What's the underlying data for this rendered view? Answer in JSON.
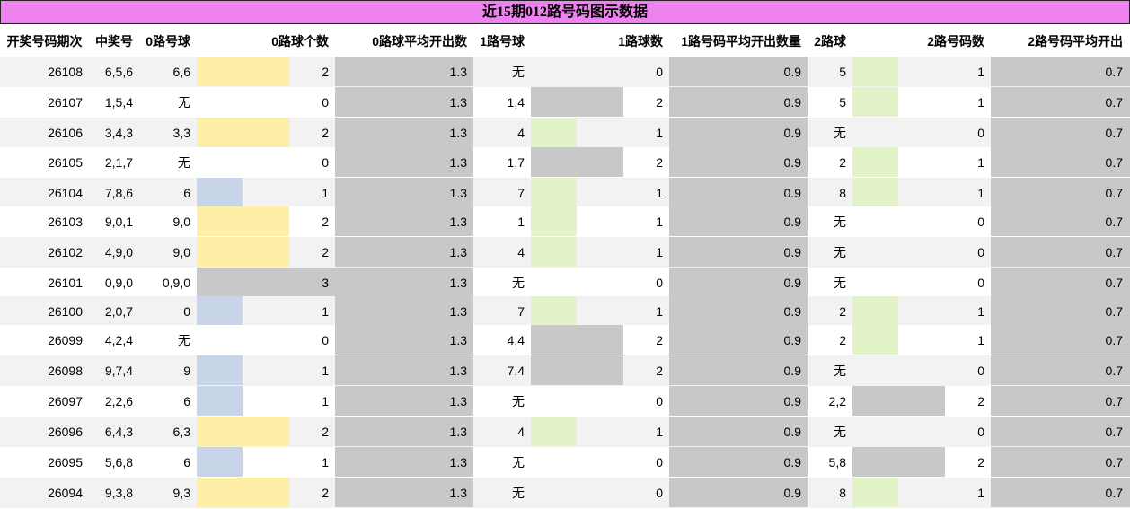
{
  "title": "近15期012路号码图示数据",
  "headers": [
    "开奖号码期次",
    "中奖号",
    "0路号球",
    "0路球个数",
    "0路球平均开出数",
    "1路号球",
    "1路球数",
    "1路号码平均开出数量",
    "2路球",
    "2路号码数",
    "2路号码平均开出"
  ],
  "colors": {
    "title_bg": "#ee82ee",
    "avg_col_bg": "#c8c8c8",
    "count1_route0": "#c8d4e8",
    "count2_route0": "#fdeea8",
    "count1_route12": "#e2f3c8",
    "count2_route12": "#c8c8c8",
    "count3": "#c8c8c8",
    "stripe": "#f2f2f2"
  },
  "max_count": 3,
  "rows": [
    {
      "period": "26108",
      "draw": "6,5,6",
      "r0_nums": "6,6",
      "r0_count": "2",
      "r0_avg": "1.3",
      "r1_nums": "无",
      "r1_count": "0",
      "r1_avg": "0.9",
      "r2_nums": "5",
      "r2_count": "1",
      "r2_avg": "0.7"
    },
    {
      "period": "26107",
      "draw": "1,5,4",
      "r0_nums": "无",
      "r0_count": "0",
      "r0_avg": "1.3",
      "r1_nums": "1,4",
      "r1_count": "2",
      "r1_avg": "0.9",
      "r2_nums": "5",
      "r2_count": "1",
      "r2_avg": "0.7"
    },
    {
      "period": "26106",
      "draw": "3,4,3",
      "r0_nums": "3,3",
      "r0_count": "2",
      "r0_avg": "1.3",
      "r1_nums": "4",
      "r1_count": "1",
      "r1_avg": "0.9",
      "r2_nums": "无",
      "r2_count": "0",
      "r2_avg": "0.7"
    },
    {
      "period": "26105",
      "draw": "2,1,7",
      "r0_nums": "无",
      "r0_count": "0",
      "r0_avg": "1.3",
      "r1_nums": "1,7",
      "r1_count": "2",
      "r1_avg": "0.9",
      "r2_nums": "2",
      "r2_count": "1",
      "r2_avg": "0.7"
    },
    {
      "period": "26104",
      "draw": "7,8,6",
      "r0_nums": "6",
      "r0_count": "1",
      "r0_avg": "1.3",
      "r1_nums": "7",
      "r1_count": "1",
      "r1_avg": "0.9",
      "r2_nums": "8",
      "r2_count": "1",
      "r2_avg": "0.7"
    },
    {
      "period": "26103",
      "draw": "9,0,1",
      "r0_nums": "9,0",
      "r0_count": "2",
      "r0_avg": "1.3",
      "r1_nums": "1",
      "r1_count": "1",
      "r1_avg": "0.9",
      "r2_nums": "无",
      "r2_count": "0",
      "r2_avg": "0.7"
    },
    {
      "period": "26102",
      "draw": "4,9,0",
      "r0_nums": "9,0",
      "r0_count": "2",
      "r0_avg": "1.3",
      "r1_nums": "4",
      "r1_count": "1",
      "r1_avg": "0.9",
      "r2_nums": "无",
      "r2_count": "0",
      "r2_avg": "0.7"
    },
    {
      "period": "26101",
      "draw": "0,9,0",
      "r0_nums": "0,9,0",
      "r0_count": "3",
      "r0_avg": "1.3",
      "r1_nums": "无",
      "r1_count": "0",
      "r1_avg": "0.9",
      "r2_nums": "无",
      "r2_count": "0",
      "r2_avg": "0.7"
    },
    {
      "period": "26100",
      "draw": "2,0,7",
      "r0_nums": "0",
      "r0_count": "1",
      "r0_avg": "1.3",
      "r1_nums": "7",
      "r1_count": "1",
      "r1_avg": "0.9",
      "r2_nums": "2",
      "r2_count": "1",
      "r2_avg": "0.7"
    },
    {
      "period": "26099",
      "draw": "4,2,4",
      "r0_nums": "无",
      "r0_count": "0",
      "r0_avg": "1.3",
      "r1_nums": "4,4",
      "r1_count": "2",
      "r1_avg": "0.9",
      "r2_nums": "2",
      "r2_count": "1",
      "r2_avg": "0.7"
    },
    {
      "period": "26098",
      "draw": "9,7,4",
      "r0_nums": "9",
      "r0_count": "1",
      "r0_avg": "1.3",
      "r1_nums": "7,4",
      "r1_count": "2",
      "r1_avg": "0.9",
      "r2_nums": "无",
      "r2_count": "0",
      "r2_avg": "0.7"
    },
    {
      "period": "26097",
      "draw": "2,2,6",
      "r0_nums": "6",
      "r0_count": "1",
      "r0_avg": "1.3",
      "r1_nums": "无",
      "r1_count": "0",
      "r1_avg": "0.9",
      "r2_nums": "2,2",
      "r2_count": "2",
      "r2_avg": "0.7"
    },
    {
      "period": "26096",
      "draw": "6,4,3",
      "r0_nums": "6,3",
      "r0_count": "2",
      "r0_avg": "1.3",
      "r1_nums": "4",
      "r1_count": "1",
      "r1_avg": "0.9",
      "r2_nums": "无",
      "r2_count": "0",
      "r2_avg": "0.7"
    },
    {
      "period": "26095",
      "draw": "5,6,8",
      "r0_nums": "6",
      "r0_count": "1",
      "r0_avg": "1.3",
      "r1_nums": "无",
      "r1_count": "0",
      "r1_avg": "0.9",
      "r2_nums": "5,8",
      "r2_count": "2",
      "r2_avg": "0.7"
    },
    {
      "period": "26094",
      "draw": "9,3,8",
      "r0_nums": "9,3",
      "r0_count": "2",
      "r0_avg": "1.3",
      "r1_nums": "无",
      "r1_count": "0",
      "r1_avg": "0.9",
      "r2_nums": "8",
      "r2_count": "1",
      "r2_avg": "0.7"
    }
  ]
}
